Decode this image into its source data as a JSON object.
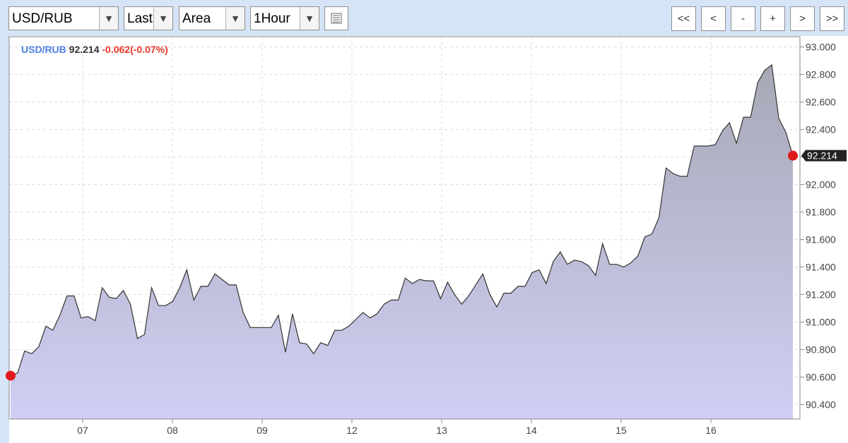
{
  "toolbar": {
    "symbol": "USD/RUB",
    "price_type": "Last",
    "chart_style": "Area",
    "interval": "1Hour",
    "nav": [
      "<<",
      "<",
      "-",
      "+",
      ">",
      ">>"
    ]
  },
  "legend": {
    "symbol": "USD/RUB",
    "last": "92.214",
    "change": "-0.062(-0.07%)"
  },
  "colors": {
    "area_top": "#a7a8b6",
    "area_bottom": "#d0cff4",
    "line": "#333333",
    "marker": "#e0191a",
    "price_tag": "#222222"
  },
  "chart_data": {
    "type": "area",
    "title": "",
    "xlabel": "",
    "ylabel": "",
    "x_ticks": [
      "07",
      "08",
      "09",
      "12",
      "13",
      "14",
      "15",
      "16"
    ],
    "y_ticks": [
      "93.000",
      "92.800",
      "92.600",
      "92.400",
      "92.200",
      "92.000",
      "91.800",
      "91.600",
      "91.400",
      "91.200",
      "91.000",
      "90.800",
      "90.600",
      "90.400"
    ],
    "ylim": [
      90.295,
      93.075
    ],
    "grid": true,
    "last_value": "92.214",
    "min_marker_value": 90.77,
    "series": [
      {
        "values": [
          90.61,
          90.63,
          90.79,
          90.77,
          90.82,
          90.97,
          90.94,
          91.05,
          91.19,
          91.19,
          91.03,
          91.04,
          91.01,
          91.25,
          91.18,
          91.17,
          91.23,
          91.13,
          90.88,
          90.91,
          91.25,
          91.12,
          91.12,
          91.15,
          91.25,
          91.38,
          91.16,
          91.26,
          91.26,
          91.35,
          91.31,
          91.27,
          91.27,
          91.07,
          90.96,
          90.96,
          90.96,
          90.96,
          91.05,
          90.78,
          91.06,
          90.85,
          90.84,
          90.77,
          90.85,
          90.83,
          90.94,
          90.94,
          90.97,
          91.02,
          91.07,
          91.03,
          91.06,
          91.13,
          91.16,
          91.16,
          91.32,
          91.28,
          91.31,
          91.3,
          91.3,
          91.17,
          91.29,
          91.2,
          91.13,
          91.19,
          91.27,
          91.35,
          91.2,
          91.11,
          91.21,
          91.21,
          91.26,
          91.26,
          91.36,
          91.38,
          91.28,
          91.44,
          91.51,
          91.42,
          91.45,
          91.44,
          91.41,
          91.34,
          91.57,
          91.42,
          91.42,
          91.4,
          91.43,
          91.48,
          91.62,
          91.64,
          91.76,
          92.12,
          92.08,
          92.06,
          92.06,
          92.28,
          92.28,
          92.28,
          92.29,
          92.39,
          92.45,
          92.3,
          92.49,
          92.49,
          92.74,
          92.83,
          92.87,
          92.48,
          92.38,
          92.21
        ]
      }
    ]
  }
}
